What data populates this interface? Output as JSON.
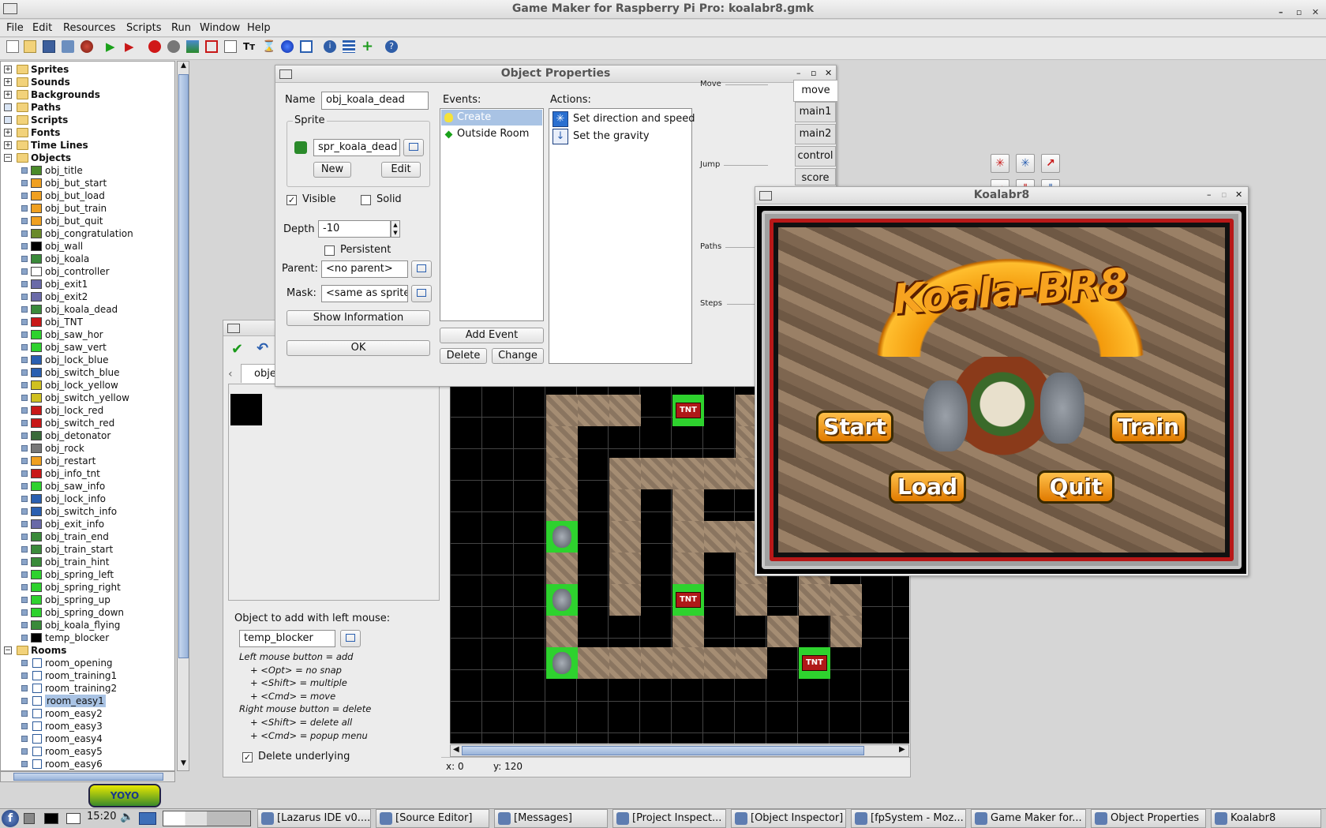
{
  "window": {
    "title": "Game Maker for Raspberry Pi Pro: koalabr8.gmk"
  },
  "menu": [
    "File",
    "Edit",
    "Resources",
    "Scripts",
    "Run",
    "Window",
    "Help"
  ],
  "tree": {
    "folders": [
      {
        "label": "Sprites",
        "expander": "+"
      },
      {
        "label": "Sounds",
        "expander": "+"
      },
      {
        "label": "Backgrounds",
        "expander": "+"
      },
      {
        "label": "Paths",
        "expander": ""
      },
      {
        "label": "Scripts",
        "expander": ""
      },
      {
        "label": "Fonts",
        "expander": "+"
      },
      {
        "label": "Time Lines",
        "expander": "+"
      },
      {
        "label": "Objects",
        "expander": "−"
      }
    ],
    "objects": [
      "obj_title",
      "obj_but_start",
      "obj_but_load",
      "obj_but_train",
      "obj_but_quit",
      "obj_congratulation",
      "obj_wall",
      "obj_koala",
      "obj_controller",
      "obj_exit1",
      "obj_exit2",
      "obj_koala_dead",
      "obj_TNT",
      "obj_saw_hor",
      "obj_saw_vert",
      "obj_lock_blue",
      "obj_switch_blue",
      "obj_lock_yellow",
      "obj_switch_yellow",
      "obj_lock_red",
      "obj_switch_red",
      "obj_detonator",
      "obj_rock",
      "obj_restart",
      "obj_info_tnt",
      "obj_saw_info",
      "obj_lock_info",
      "obj_switch_info",
      "obj_exit_info",
      "obj_train_end",
      "obj_train_start",
      "obj_train_hint",
      "obj_spring_left",
      "obj_spring_right",
      "obj_spring_up",
      "obj_spring_down",
      "obj_koala_flying",
      "temp_blocker"
    ],
    "rooms_folder": {
      "label": "Rooms",
      "expander": "−"
    },
    "rooms": [
      "room_opening",
      "room_training1",
      "room_training2",
      "room_easy1",
      "room_easy2",
      "room_easy3",
      "room_easy4",
      "room_easy5",
      "room_easy6"
    ],
    "selected_room": "room_easy1",
    "logo": "YOYO GAMES"
  },
  "object_properties": {
    "title": "Object Properties",
    "name_label": "Name",
    "name_value": "obj_koala_dead",
    "sprite_label": "Sprite",
    "sprite_value": "spr_koala_dead",
    "new_label": "New",
    "edit_label": "Edit",
    "visible_label": "Visible",
    "solid_label": "Solid",
    "depth_label": "Depth",
    "depth_value": "-10",
    "persistent_label": "Persistent",
    "parent_label": "Parent:",
    "parent_value": "<no parent>",
    "mask_label": "Mask:",
    "mask_value": "<same as sprite>",
    "show_info_label": "Show Information",
    "ok_label": "OK",
    "events_label": "Events:",
    "events": [
      "Create",
      "Outside Room"
    ],
    "add_event_label": "Add Event",
    "delete_label": "Delete",
    "change_label": "Change",
    "actions_label": "Actions:",
    "actions": [
      "Set direction and speed",
      "Set the gravity"
    ],
    "groups": {
      "move": "Move",
      "jump": "Jump",
      "paths": "Paths",
      "steps": "Steps"
    },
    "tabs": [
      "move",
      "main1",
      "main2",
      "control",
      "score"
    ]
  },
  "room_editor": {
    "tab_label": "obje",
    "object_to_add_label": "Object to add with left mouse:",
    "object_to_add_value": "temp_blocker",
    "help_lines": [
      "Left mouse button = add",
      "+ <Opt> = no snap",
      "+ <Shift> = multiple",
      "+ <Cmd> = move",
      "Right mouse button = delete",
      "+ <Shift> = delete all",
      "+ <Cmd> = popup menu"
    ],
    "delete_underlying_label": "Delete underlying",
    "status_x": "x: 0",
    "status_y": "y: 120",
    "tnt_label": "TNT"
  },
  "game_window": {
    "title": "Koalabr8",
    "logo_text": "Koala-BR8",
    "buttons": {
      "start": "Start",
      "train": "Train",
      "load": "Load",
      "quit": "Quit"
    }
  },
  "taskbar": {
    "clock": "15:20",
    "tasks": [
      "[Lazarus IDE v0....",
      "[Source Editor]",
      "[Messages]",
      "[Project Inspect...",
      "[Object Inspector]",
      "[fpSystem - Moz...",
      "Game Maker for...",
      "Object Properties",
      "Koalabr8"
    ]
  },
  "colors": {
    "selection": "#a9c3e4",
    "accent_blue": "#3d6fb8",
    "wall_tile": "#9a8268",
    "koala_bg": "#2ed22e"
  }
}
